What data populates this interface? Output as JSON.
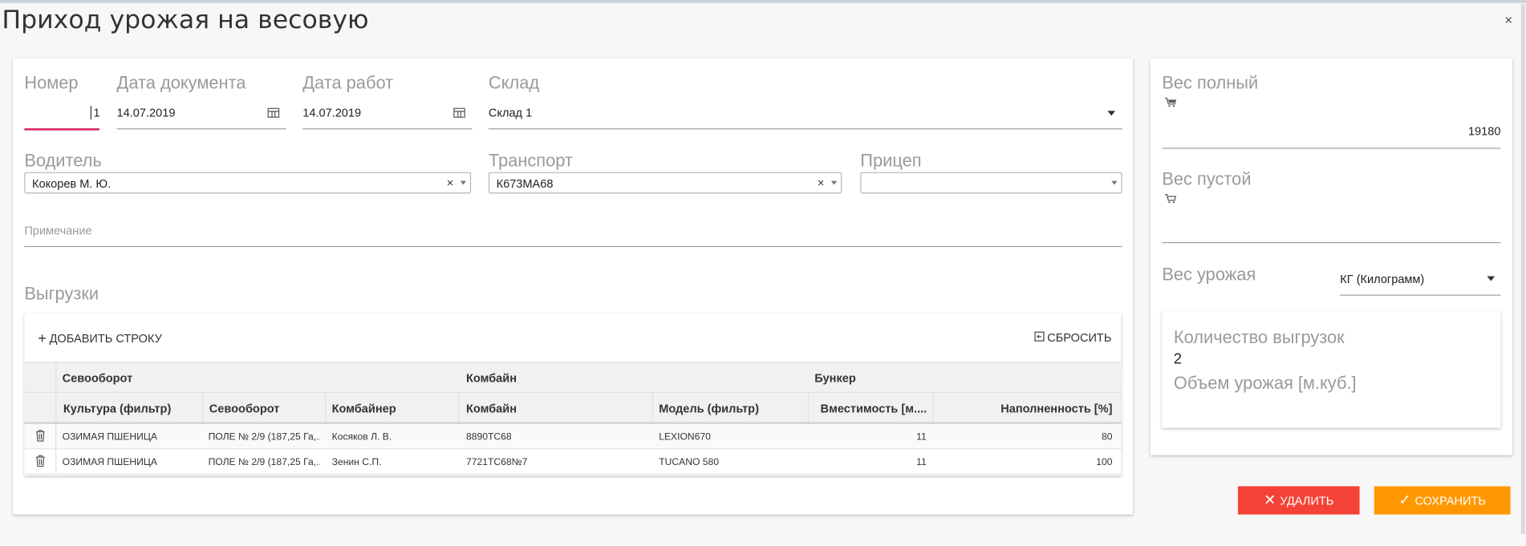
{
  "window": {
    "title": "Приход урожая на весовую",
    "close_label": "×"
  },
  "form": {
    "number": {
      "label": "Номер",
      "value": "1"
    },
    "doc_date": {
      "label": "Дата документа",
      "value": "14.07.2019"
    },
    "work_date": {
      "label": "Дата работ",
      "value": "14.07.2019"
    },
    "warehouse": {
      "label": "Склад",
      "value": "Склад 1"
    },
    "driver": {
      "label": "Водитель",
      "value": "Кокорев М. Ю.",
      "clear": "×"
    },
    "transport": {
      "label": "Транспорт",
      "value": "К673МА68",
      "clear": "×"
    },
    "trailer": {
      "label": "Прицеп",
      "value": ""
    },
    "note": {
      "label": "Примечание",
      "value": ""
    }
  },
  "unloads": {
    "section_title": "Выгрузки",
    "add_row_label": "ДОБАВИТЬ СТРОКУ",
    "reset_label": "СБРОСИТЬ",
    "group_headers": [
      "Севооборот",
      "Комбайн",
      "Бункер"
    ],
    "columns": [
      "Культура (фильтр)",
      "Севооборот",
      "Комбайнер",
      "Комбайн",
      "Модель (фильтр)",
      "Вместимость [м....",
      "Наполненность [%]"
    ],
    "rows": [
      [
        "ОЗИМАЯ ПШЕНИЦА",
        "ПОЛЕ № 2/9 (187,25 Га,...",
        "Косяков Л. В.",
        "8890ТС68",
        "LEXION670",
        "11",
        "80"
      ],
      [
        "ОЗИМАЯ ПШЕНИЦА",
        "ПОЛЕ № 2/9 (187,25 Га,...",
        "Зенин С.П.",
        "7721ТС68№7",
        "TUCANO 580",
        "11",
        "100"
      ]
    ]
  },
  "weights": {
    "full": {
      "label": "Вес полный",
      "value": "19180"
    },
    "empty": {
      "label": "Вес пустой",
      "value": ""
    },
    "harvest": {
      "label": "Вес урожая",
      "unit": "КГ (Килограмм)"
    }
  },
  "summary": {
    "unload_count_label": "Количество выгрузок",
    "unload_count_value": "2",
    "volume_label": "Объем урожая [м.куб.]"
  },
  "actions": {
    "delete_label": "УДАЛИТЬ",
    "save_label": "СОХРАНИТЬ"
  },
  "colors": {
    "accent": "#d81b60",
    "delete": "#f44336",
    "save": "#ff9800"
  },
  "icons": [
    "calendar-icon",
    "dropdown-arrow-icon",
    "clear-icon",
    "plus-icon",
    "reset-icon",
    "trash-icon",
    "cart-full-icon",
    "cart-empty-icon",
    "close-icon",
    "check-icon"
  ]
}
